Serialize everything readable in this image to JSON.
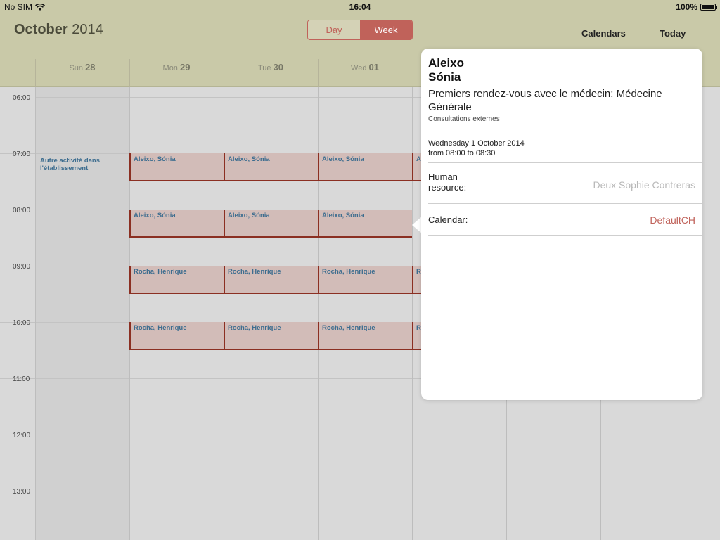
{
  "status": {
    "carrier": "No SIM",
    "time": "16:04",
    "battery": "100%",
    "battery_level": 1.0,
    "icons": [
      "wifi-icon",
      "battery-icon"
    ]
  },
  "header": {
    "month": "October",
    "year": "2014",
    "seg_day": "Day",
    "seg_week": "Week",
    "selected": "Week",
    "calendars": "Calendars",
    "today": "Today"
  },
  "days": [
    {
      "dow": "Sun",
      "num": "28"
    },
    {
      "dow": "Mon",
      "num": "29"
    },
    {
      "dow": "Tue",
      "num": "30"
    },
    {
      "dow": "Wed",
      "num": "01"
    }
  ],
  "times": [
    "06:00",
    "07:00",
    "08:00",
    "09:00",
    "10:00",
    "11:00",
    "12:00",
    "13:00"
  ],
  "events": {
    "allday": "Autre activité dans l'établissement",
    "aleixo": "Aleixo, Sónia",
    "rocha": "Rocha, Henrique",
    "partial": "A",
    "partial_r": "R"
  },
  "popover": {
    "last_name": "Aleixo",
    "first_name": "Sónia",
    "description": "Premiers rendez-vous avec le médecin: Médecine Générale",
    "subtitle": "Consultations externes",
    "date": "Wednesday 1 October 2014",
    "time_range": "from 08:00 to 08:30",
    "resource_label": "Human resource:",
    "resource_value": "Deux Sophie Contreras",
    "calendar_label": "Calendar:",
    "calendar_value": "DefaultCH"
  },
  "colors": {
    "header_bg": "#c9c9a8",
    "accent": "#c0625a",
    "event_bg": "#d2bcb8",
    "event_border": "#8b2f22",
    "event_text": "#3d6d8f"
  }
}
